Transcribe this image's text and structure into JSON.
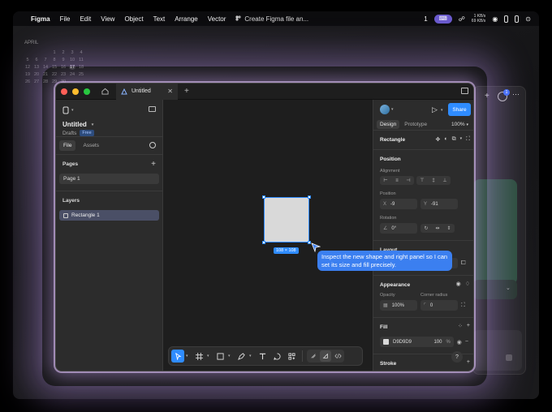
{
  "menubar": {
    "app": "Figma",
    "items": [
      "File",
      "Edit",
      "View",
      "Object",
      "Text",
      "Arrange",
      "Vector"
    ],
    "file_title": "Create Figma file an...",
    "badge_count": "1",
    "net_up": "1 KB/s",
    "net_down": "69 KB/s"
  },
  "calendar": {
    "month": "APRIL",
    "rows": [
      [
        "",
        "",
        "",
        "",
        "",
        "",
        ""
      ],
      [
        "",
        "",
        "",
        "1",
        "2",
        "3",
        "4"
      ],
      [
        "5",
        "6",
        "7",
        "8",
        "9",
        "10",
        "11"
      ],
      [
        "12",
        "13",
        "14",
        "15",
        "16",
        "17",
        "18"
      ],
      [
        "19",
        "20",
        "21",
        "22",
        "23",
        "24",
        "25"
      ],
      [
        "26",
        "27",
        "28",
        "29",
        "30",
        "",
        ""
      ]
    ],
    "today": "17"
  },
  "window": {
    "tab_title": "Untitled"
  },
  "left_panel": {
    "file_name": "Untitled",
    "location": "Drafts",
    "plan_badge": "Free",
    "tabs": [
      "File",
      "Assets"
    ],
    "pages_title": "Pages",
    "pages": [
      "Page 1"
    ],
    "layers_title": "Layers",
    "layers": [
      "Rectangle 1"
    ]
  },
  "canvas": {
    "size_label": "108 × 108",
    "tooltip": "Inspect the new shape and right panel so I can set its size and fill precisely."
  },
  "right_panel": {
    "share_label": "Share",
    "tabs": [
      "Design",
      "Prototype"
    ],
    "zoom": "100%",
    "selection_title": "Rectangle",
    "position_title": "Position",
    "alignment_label": "Alignment",
    "position_label": "Position",
    "x_label": "X",
    "x_value": "-9",
    "y_label": "Y",
    "y_value": "-91",
    "rotation_label": "Rotation",
    "rotation_value": "0°",
    "layout_title": "Layout",
    "w_value": "108",
    "h_value": "108",
    "appearance_title": "Appearance",
    "opacity_label": "Opacity",
    "opacity_value": "100%",
    "radius_label": "Corner radius",
    "radius_value": "0",
    "fill_title": "Fill",
    "fill_hex": "D9D9D9",
    "fill_opacity": "100",
    "fill_pct": "%",
    "stroke_title": "Stroke",
    "help": "?"
  },
  "colors": {
    "accent": "#2f8cff",
    "fill": "#D9D9D9",
    "tooltip": "#3b7ff0"
  }
}
